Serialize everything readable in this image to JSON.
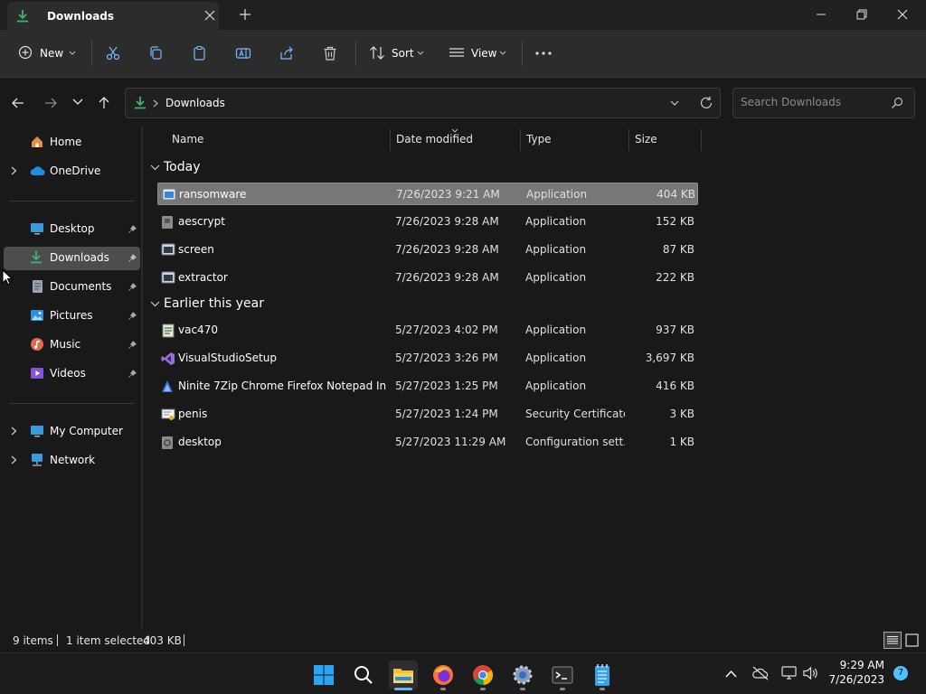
{
  "window": {
    "tab_title": "Downloads"
  },
  "toolbar": {
    "new_label": "New",
    "sort_label": "Sort",
    "view_label": "View"
  },
  "address": {
    "path": "Downloads"
  },
  "search": {
    "placeholder": "Search Downloads"
  },
  "nav": {
    "home": "Home",
    "onedrive": "OneDrive",
    "desktop": "Desktop",
    "downloads": "Downloads",
    "documents": "Documents",
    "pictures": "Pictures",
    "music": "Music",
    "videos": "Videos",
    "mycomputer": "My Computer",
    "network": "Network"
  },
  "columns": {
    "name": "Name",
    "date": "Date modified",
    "type": "Type",
    "size": "Size"
  },
  "groups": {
    "today": "Today",
    "earlier": "Earlier this year"
  },
  "files": [
    {
      "name": "ransomware",
      "date": "7/26/2023 9:21 AM",
      "type": "Application",
      "size": "404 KB"
    },
    {
      "name": "aescrypt",
      "date": "7/26/2023 9:28 AM",
      "type": "Application",
      "size": "152 KB"
    },
    {
      "name": "screen",
      "date": "7/26/2023 9:28 AM",
      "type": "Application",
      "size": "87 KB"
    },
    {
      "name": "extractor",
      "date": "7/26/2023 9:28 AM",
      "type": "Application",
      "size": "222 KB"
    },
    {
      "name": "vac470",
      "date": "5/27/2023 4:02 PM",
      "type": "Application",
      "size": "937 KB"
    },
    {
      "name": "VisualStudioSetup",
      "date": "5/27/2023 3:26 PM",
      "type": "Application",
      "size": "3,697 KB"
    },
    {
      "name": "Ninite 7Zip Chrome Firefox Notepad Inst...",
      "date": "5/27/2023 1:25 PM",
      "type": "Application",
      "size": "416 KB"
    },
    {
      "name": "penis",
      "date": "5/27/2023 1:24 PM",
      "type": "Security Certificate",
      "size": "3 KB"
    },
    {
      "name": "desktop",
      "date": "5/27/2023 11:29 AM",
      "type": "Configuration sett...",
      "size": "1 KB"
    }
  ],
  "status": {
    "items": "9 items",
    "selected": "1 item selected",
    "selected_size": "403 KB"
  },
  "clock": {
    "time": "9:29 AM",
    "date": "7/26/2023"
  },
  "notifications": "7"
}
